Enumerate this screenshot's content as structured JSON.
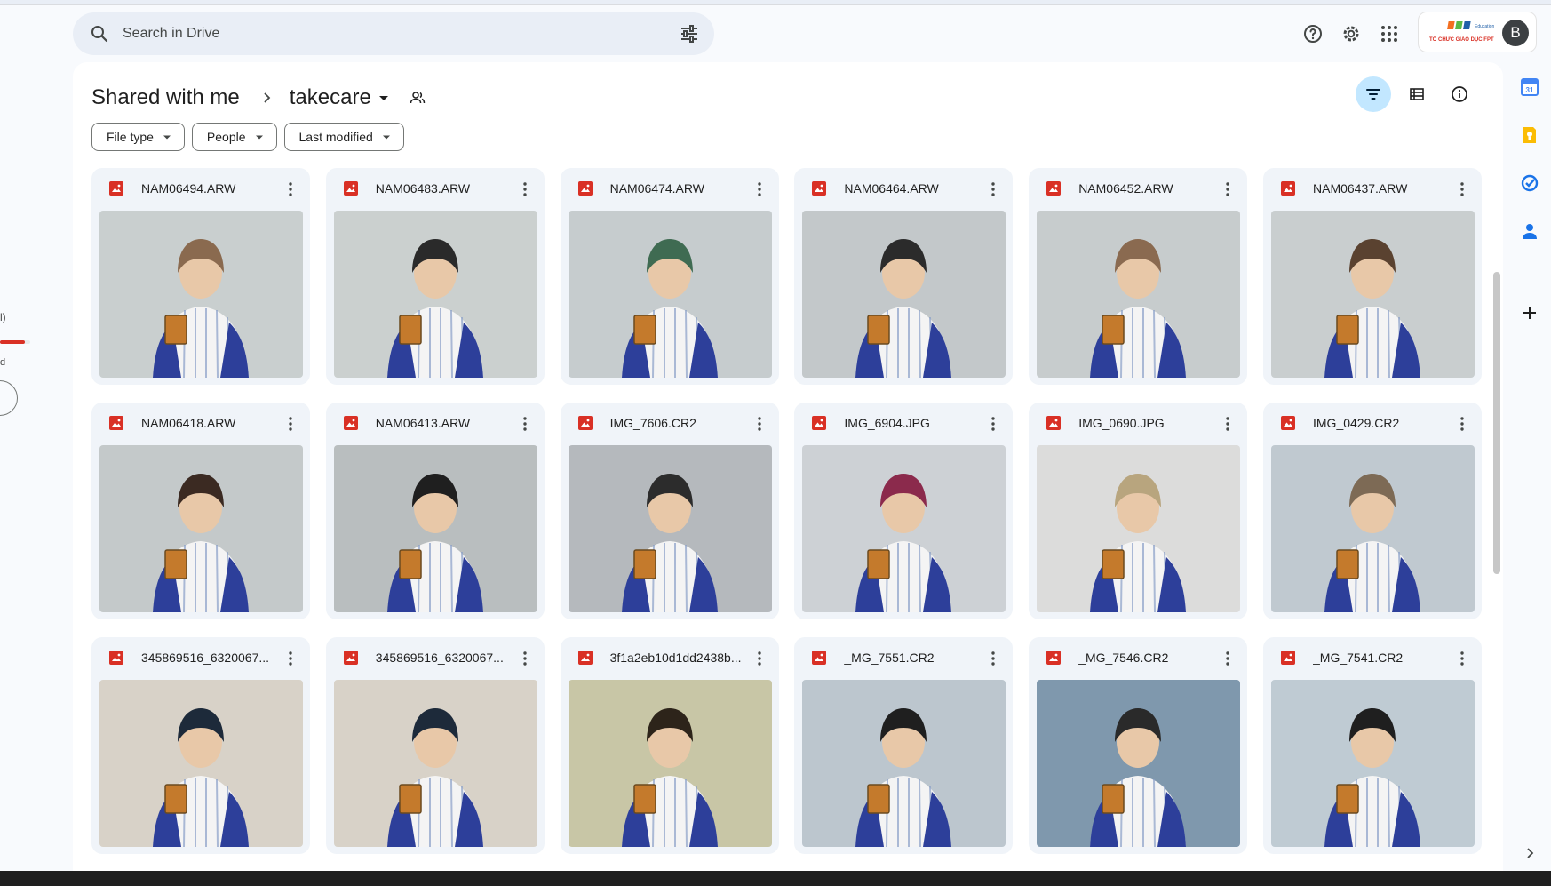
{
  "sidebar_fragment": {
    "text1": "l)",
    "text2": "d"
  },
  "search": {
    "placeholder": "Search in Drive"
  },
  "account": {
    "avatar_letter": "B",
    "brand_text": "TỔ CHỨC GIÁO DỤC FPT"
  },
  "breadcrumb": {
    "root": "Shared with me",
    "folder": "takecare"
  },
  "filters": [
    {
      "label": "File type"
    },
    {
      "label": "People"
    },
    {
      "label": "Last modified"
    }
  ],
  "icons": {
    "search": "search-icon",
    "tune": "tune-icon",
    "help": "help-icon",
    "settings": "gear-icon",
    "apps": "apps-grid-icon",
    "filter": "filter-icon",
    "list_view": "list-view-icon",
    "info": "info-icon",
    "side": [
      "calendar-icon",
      "keep-icon",
      "tasks-icon",
      "contacts-icon",
      "add-icon",
      "chevron-right-icon"
    ]
  },
  "colors": {
    "accent": "#c2e7ff",
    "file_icon": "#d93025",
    "card_bg": "#f0f4f9"
  },
  "files": [
    {
      "name": "NAM06494.ARW",
      "bg": "#c9cfcf",
      "fg": "#8a6a4f"
    },
    {
      "name": "NAM06483.ARW",
      "bg": "#cbd0cf",
      "fg": "#2a2a2a"
    },
    {
      "name": "NAM06474.ARW",
      "bg": "#c6ccce",
      "fg": "#3f6b52"
    },
    {
      "name": "NAM06464.ARW",
      "bg": "#c3c8ca",
      "fg": "#2b2b2b"
    },
    {
      "name": "NAM06452.ARW",
      "bg": "#c7cccd",
      "fg": "#8a6a50"
    },
    {
      "name": "NAM06437.ARW",
      "bg": "#c9cecf",
      "fg": "#5a4230"
    },
    {
      "name": "NAM06418.ARW",
      "bg": "#c4c9ca",
      "fg": "#3b2a22"
    },
    {
      "name": "NAM06413.ARW",
      "bg": "#b9bebf",
      "fg": "#1f1f1f"
    },
    {
      "name": "IMG_7606.CR2",
      "bg": "#b5b9bd",
      "fg": "#2c2c2c"
    },
    {
      "name": "IMG_6904.JPG",
      "bg": "#cdd1d5",
      "fg": "#8b2a4c"
    },
    {
      "name": "IMG_0690.JPG",
      "bg": "#dcdcdb",
      "fg": "#b8a57e"
    },
    {
      "name": "IMG_0429.CR2",
      "bg": "#c0c9d0",
      "fg": "#7d6a55"
    },
    {
      "name": "345869516_6320067...",
      "bg": "#d8d2c8",
      "fg": "#1d2a3a"
    },
    {
      "name": "345869516_6320067...",
      "bg": "#d8d2c8",
      "fg": "#1d2a3a"
    },
    {
      "name": "3f1a2eb10d1dd2438b...",
      "bg": "#c8c6a6",
      "fg": "#2d241a"
    },
    {
      "name": "_MG_7551.CR2",
      "bg": "#bcc6ce",
      "fg": "#1f1f1f"
    },
    {
      "name": "_MG_7546.CR2",
      "bg": "#7f98ad",
      "fg": "#2a2a2a"
    },
    {
      "name": "_MG_7541.CR2",
      "bg": "#bfcbd3",
      "fg": "#1f1f1f"
    }
  ]
}
